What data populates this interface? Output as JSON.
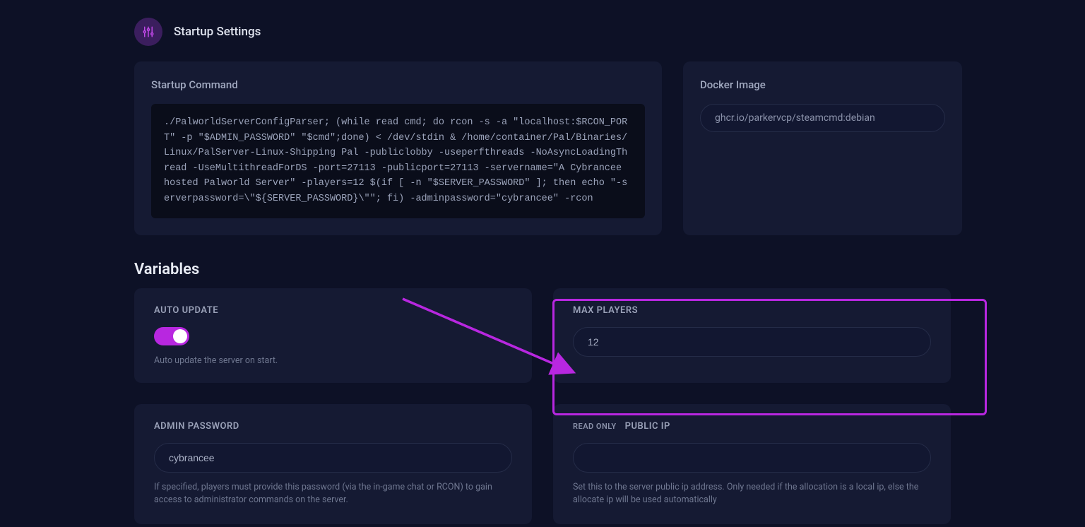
{
  "header": {
    "title": "Startup Settings"
  },
  "startup_command": {
    "title": "Startup Command",
    "code": "./PalworldServerConfigParser; (while read cmd; do rcon -s -a \"localhost:$RCON_PORT\" -p \"$ADMIN_PASSWORD\" \"$cmd\";done) < /dev/stdin & /home/container/Pal/Binaries/Linux/PalServer-Linux-Shipping Pal -publiclobby -useperfthreads -NoAsyncLoadingThread -UseMultithreadForDS -port=27113 -publicport=27113 -servername=\"A Cybrancee hosted Palworld Server\" -players=12 $(if [ -n \"$SERVER_PASSWORD\" ]; then echo \"-serverpassword=\\\"${SERVER_PASSWORD}\\\"\"; fi) -adminpassword=\"cybrancee\" -rcon"
  },
  "docker": {
    "title": "Docker Image",
    "value": "ghcr.io/parkervcp/steamcmd:debian"
  },
  "variables": {
    "heading": "Variables",
    "auto_update": {
      "label": "AUTO UPDATE",
      "desc": "Auto update the server on start."
    },
    "max_players": {
      "label": "MAX PLAYERS",
      "value": "12"
    },
    "admin_password": {
      "label": "ADMIN PASSWORD",
      "value": "cybrancee",
      "desc": "If specified, players must provide this password (via the in-game chat or RCON) to gain access to administrator commands on the server."
    },
    "public_ip": {
      "readonly": "READ ONLY",
      "label": "PUBLIC IP",
      "value": "",
      "desc": "Set this to the server public ip address. Only needed if the allocation is a local ip, else the allocate ip will be used automatically"
    }
  }
}
